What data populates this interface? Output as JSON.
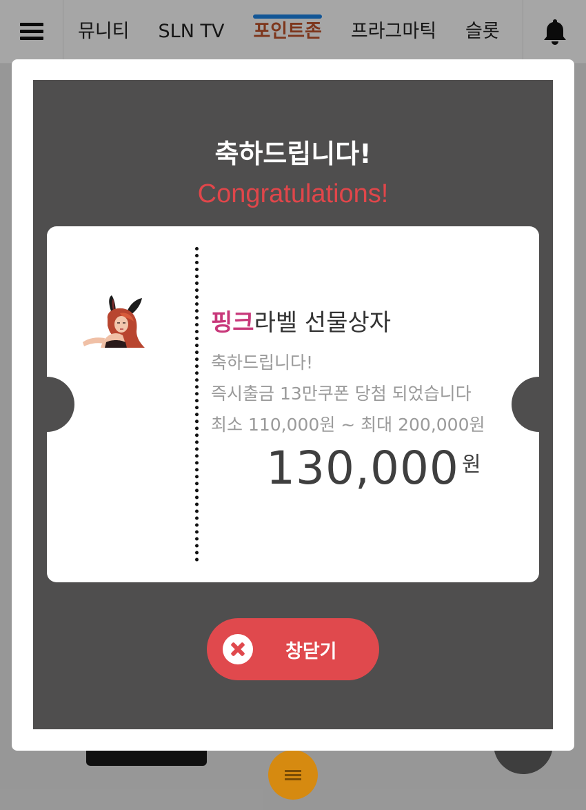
{
  "nav": {
    "tabs": [
      {
        "label": "뮤니티"
      },
      {
        "label": "SLN TV"
      },
      {
        "label": "포인트존"
      },
      {
        "label": "프라그마틱"
      },
      {
        "label": "슬롯"
      }
    ],
    "active_tab": "포인트존",
    "menu_icon": "hamburger-menu-icon",
    "bell_icon": "bell-icon"
  },
  "modal": {
    "title_ko": "축하드립니다!",
    "title_en": "Congratulations!",
    "ticket": {
      "prize_brand": "핑크",
      "prize_name": "라벨 선물상자",
      "line1": "축하드립니다!",
      "line2": "즉시출금 13만쿠폰 당첨 되었습니다",
      "line3": "최소 110,000원 ~ 최대 200,000원",
      "amount": "130,000",
      "amount_unit": "원"
    },
    "close_label": "창닫기"
  },
  "colors": {
    "active_tab": "#c0532b",
    "active_indicator": "#1d84e6",
    "title_en": "#e0464a",
    "brand": "#c8387a",
    "close_button": "#e0494d",
    "modal_inner": "#4f4e4e"
  }
}
